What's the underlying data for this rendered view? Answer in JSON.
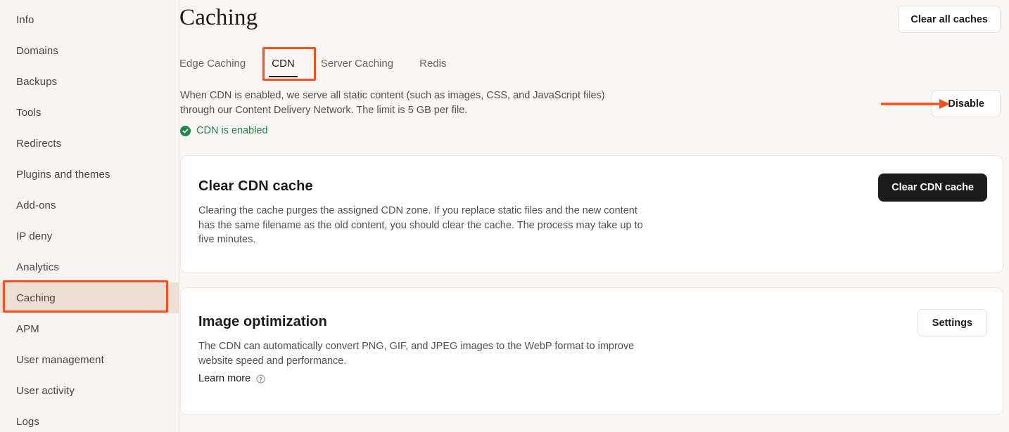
{
  "sidebar": {
    "items": [
      {
        "label": "Info",
        "active": false
      },
      {
        "label": "Domains",
        "active": false
      },
      {
        "label": "Backups",
        "active": false
      },
      {
        "label": "Tools",
        "active": false
      },
      {
        "label": "Redirects",
        "active": false
      },
      {
        "label": "Plugins and themes",
        "active": false
      },
      {
        "label": "Add-ons",
        "active": false
      },
      {
        "label": "IP deny",
        "active": false
      },
      {
        "label": "Analytics",
        "active": false
      },
      {
        "label": "Caching",
        "active": true
      },
      {
        "label": "APM",
        "active": false
      },
      {
        "label": "User management",
        "active": false
      },
      {
        "label": "User activity",
        "active": false
      },
      {
        "label": "Logs",
        "active": false
      }
    ]
  },
  "header": {
    "title": "Caching",
    "clear_all_label": "Clear all caches"
  },
  "tabs": [
    {
      "label": "Edge Caching",
      "active": false
    },
    {
      "label": "CDN",
      "active": true
    },
    {
      "label": "Server Caching",
      "active": false
    },
    {
      "label": "Redis",
      "active": false
    }
  ],
  "cdn": {
    "description": "When CDN is enabled, we serve all static content (such as images, CSS, and JavaScript files) through our Content Delivery Network. The limit is 5 GB per file.",
    "status_text": "CDN is enabled",
    "status_icon": "check-circle-icon",
    "disable_label": "Disable"
  },
  "cards": {
    "clear_cdn_cache": {
      "title": "Clear CDN cache",
      "description": "Clearing the cache purges the assigned CDN zone. If you replace static files and the new content has the same filename as the old content, you should clear the cache. The process may take up to five minutes.",
      "button_label": "Clear CDN cache"
    },
    "image_optimization": {
      "title": "Image optimization",
      "description": "The CDN can automatically convert PNG, GIF, and JPEG images to the WebP format to improve website speed and performance.",
      "learn_more_label": "Learn more",
      "learn_more_icon": "help-circle-icon",
      "button_label": "Settings"
    }
  },
  "annotations": {
    "highlight_color": "#F4511E",
    "arrow_color": "#F4511E",
    "sidebar_highlight_target": "Caching",
    "tab_highlight_target": "CDN",
    "arrow_target": "Disable"
  },
  "colors": {
    "page_background": "#FAF6F3",
    "sidebar_background": "#F8F4F1",
    "active_nav_background": "#EDDFD5",
    "card_background": "#FFFFFF",
    "primary_button": "#1C1C1C",
    "status_green": "#1E8449"
  }
}
